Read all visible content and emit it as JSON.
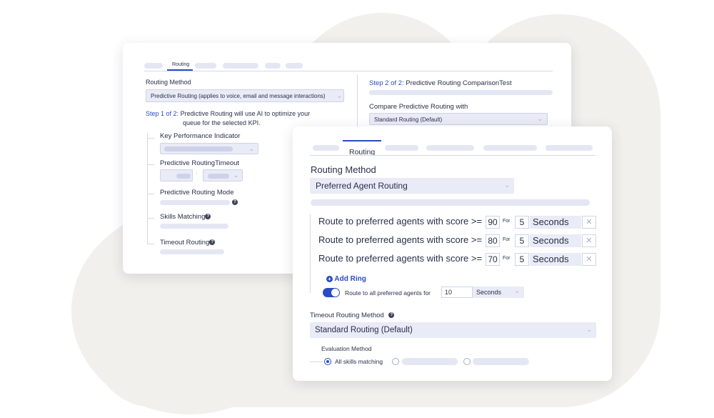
{
  "back_panel": {
    "tab_active": "Routing",
    "routing_method_label": "Routing Method",
    "routing_method_value": "Predictive Routing (applies to voice, email and message interactions)",
    "step1_prefix": "Step 1 of 2:",
    "step1_text": "Predictive Routing will use AI to optimize your",
    "step1_text2": "queue for the selected KPI.",
    "kpi_label": "Key Performance Indicator",
    "timeout_label": "Predictive RoutingTimeout",
    "mode_label": "Predictive Routing Mode",
    "skills_label": "Skills Matching",
    "timeout_routing_label": "Timeout Routing",
    "step2_prefix": "Step 2 of 2:",
    "step2_text": "Predictive Routing ComparisonTest",
    "compare_label": "Compare Predictive Routing with",
    "compare_value": "Standard Routing (Default)"
  },
  "front_panel": {
    "tab_active": "Routing",
    "routing_method_label": "Routing Method",
    "routing_method_value": "Preferred Agent Routing",
    "rings": [
      {
        "label": "Route to preferred agents with score >=",
        "score": "90",
        "for_label": "For",
        "duration": "5",
        "unit": "Seconds"
      },
      {
        "label": "Route to preferred agents with score >=",
        "score": "80",
        "for_label": "For",
        "duration": "5",
        "unit": "Seconds"
      },
      {
        "label": "Route to preferred agents with score >=",
        "score": "70",
        "for_label": "For",
        "duration": "5",
        "unit": "Seconds"
      }
    ],
    "add_ring": "Add Ring",
    "route_all_label": "Route to all preferred agents for",
    "route_all_value": "10",
    "route_all_unit": "Seconds",
    "timeout_method_label": "Timeout Routing Method",
    "timeout_method_value": "Standard Routing (Default)",
    "evaluation_label": "Evaluation Method",
    "evaluation_option_selected": "All skills matching"
  },
  "colors": {
    "accent": "#2a4cc2",
    "placeholder": "#e4e6f3",
    "background_blob": "#f1f0ec"
  },
  "icons": [
    "chevron-down-icon",
    "help-icon",
    "close-icon",
    "plus-circle-icon",
    "toggle-icon",
    "radio-icon"
  ]
}
